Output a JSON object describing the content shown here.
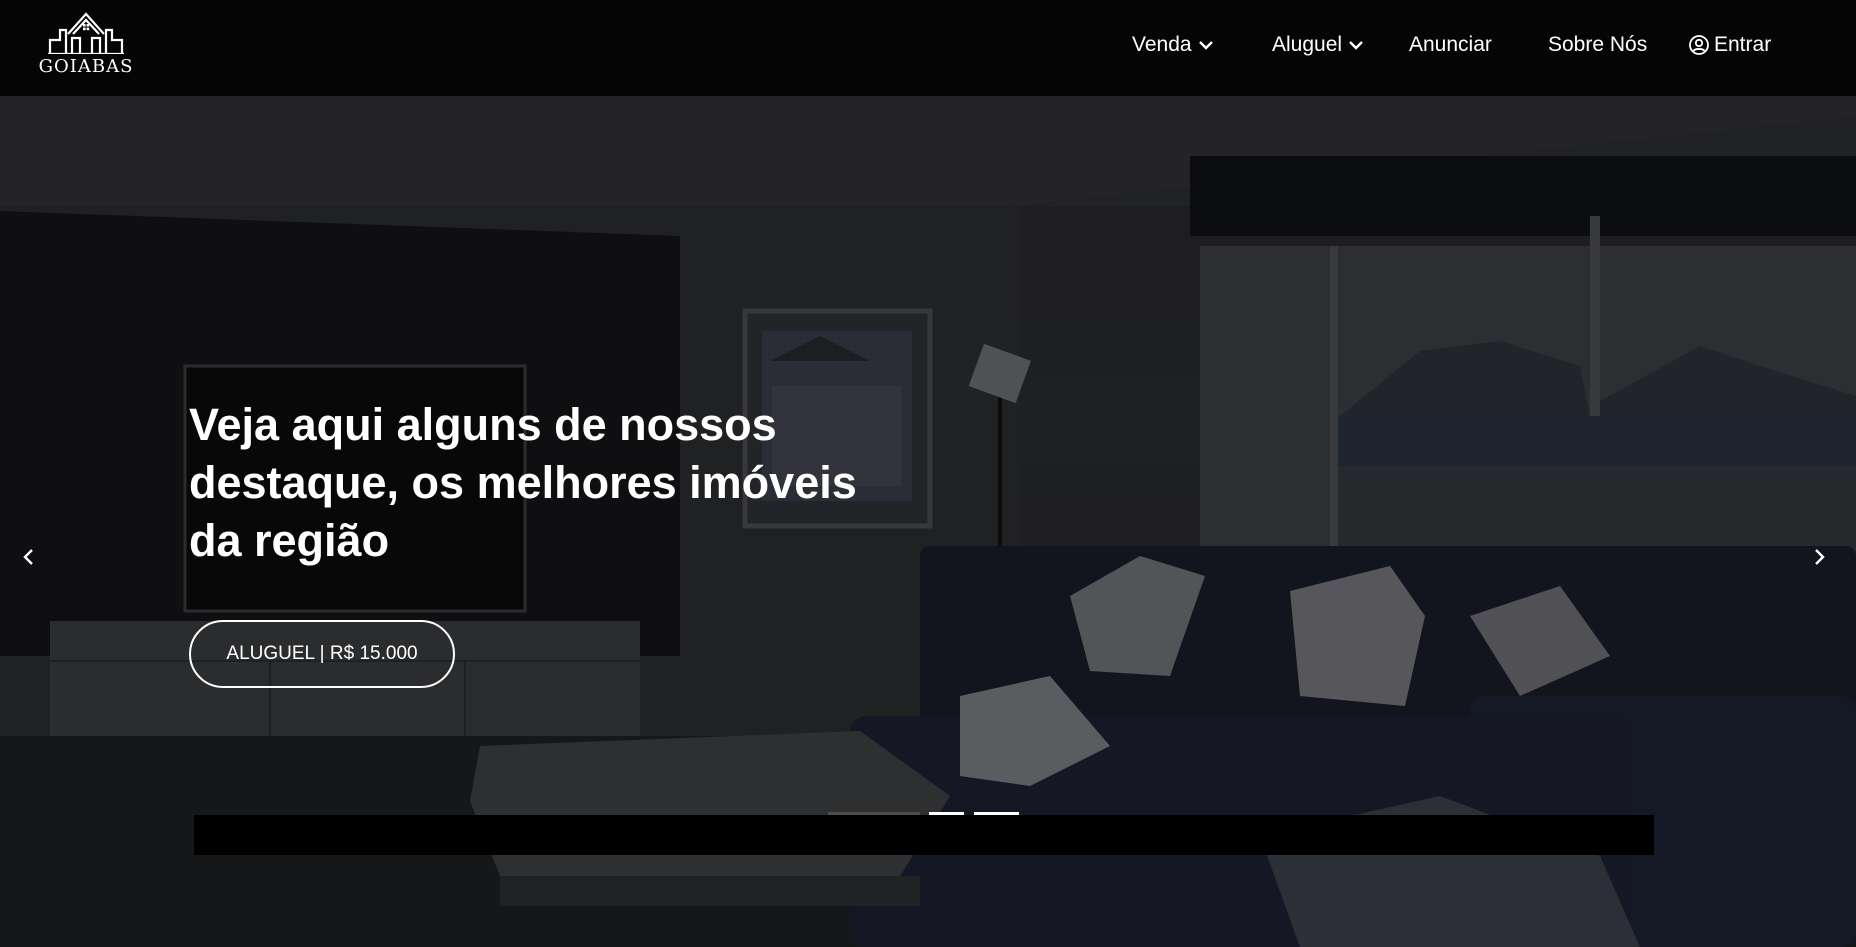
{
  "brand": {
    "name": "GOIABAS"
  },
  "nav": {
    "items": [
      {
        "label": "Venda",
        "has_dropdown": true
      },
      {
        "label": "Aluguel",
        "has_dropdown": true
      },
      {
        "label": "Anunciar",
        "has_dropdown": false
      },
      {
        "label": "Sobre Nós",
        "has_dropdown": false
      }
    ],
    "login": {
      "label": "Entrar",
      "icon": "user-circle-icon"
    }
  },
  "hero": {
    "title": "Veja aqui alguns de nossos destaque, os melhores imóveis da região",
    "cta_label": "ALUGUEL | R$ 15.000",
    "prev_icon": "chevron-left-icon",
    "next_icon": "chevron-right-icon",
    "slides": {
      "count": 3,
      "active": 0
    }
  },
  "colors": {
    "navbar_bg": "#050505",
    "text": "#ffffff",
    "indicator_active": "#4d4d4d",
    "indicator_inactive": "#ffffff"
  }
}
